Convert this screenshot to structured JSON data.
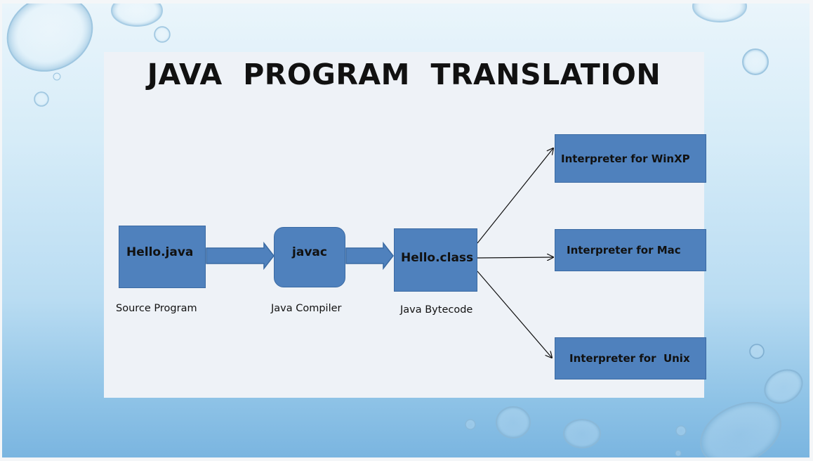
{
  "title": "JAVA  PROGRAM  TRANSLATION",
  "nodes": {
    "source": "Hello.java",
    "compiler": "javac",
    "bytecode": "Hello.class",
    "interp_winxp": "Interpreter for WinXP",
    "interp_mac": "Interpreter for Mac",
    "interp_unix": "Interpreter for  Unix"
  },
  "captions": {
    "source": "Source Program",
    "compiler": "Java Compiler",
    "bytecode": "Java Bytecode"
  },
  "colors": {
    "box_fill": "#4f81bd",
    "box_border": "#3a6aa3",
    "panel": "#eef2f7"
  }
}
